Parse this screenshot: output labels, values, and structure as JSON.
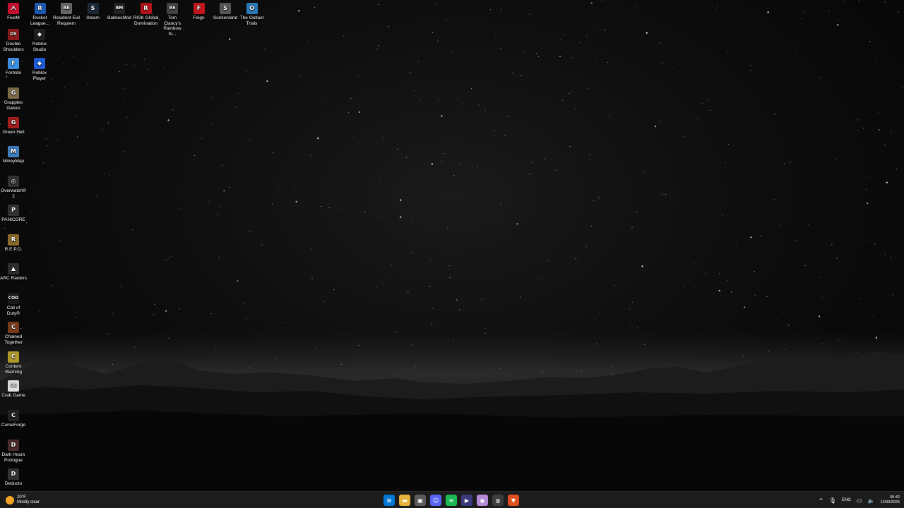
{
  "desktop_icons": [
    {
      "label": "FiveM",
      "glyph": "ᗅ",
      "color": "#c8102e"
    },
    {
      "label": "Rocket League...",
      "glyph": "R",
      "color": "#1c5bb5"
    },
    {
      "label": "Resident Evil Requiem",
      "glyph": "RE",
      "color": "#666666"
    },
    {
      "label": "Steam",
      "glyph": "S",
      "color": "#1b2838"
    },
    {
      "label": "BakkesMod",
      "glyph": "BM",
      "color": "#222222"
    },
    {
      "label": "RISK Global Domination",
      "glyph": "R",
      "color": "#b3121b"
    },
    {
      "label": "Tom Clancy's Rainbow Si...",
      "glyph": "R6",
      "color": "#444444"
    },
    {
      "label": "Feign",
      "glyph": "F",
      "color": "#c4161c"
    },
    {
      "label": "Sunkenland",
      "glyph": "S",
      "color": "#555555"
    },
    {
      "label": "The Outlast Trials",
      "glyph": "O",
      "color": "#2a7ab8"
    },
    {
      "label": "Double Shoulders",
      "glyph": "DS",
      "color": "#8b1a1a"
    },
    {
      "label": "Roblox Studio",
      "glyph": "◆",
      "color": "#1f1f1f"
    },
    {
      "label": "Fortnite",
      "glyph": "F",
      "color": "#3b8fe0"
    },
    {
      "label": "Roblox Player",
      "glyph": "◆",
      "color": "#1e5bd8"
    },
    {
      "label": "Grapples Galore",
      "glyph": "G",
      "color": "#7a6a45"
    },
    {
      "label": "Green Hell",
      "glyph": "G",
      "color": "#a01e1e"
    },
    {
      "label": "MineyMap",
      "glyph": "M",
      "color": "#3f7fbf"
    },
    {
      "label": "Overwatch® 2",
      "glyph": "◎",
      "color": "#303030"
    },
    {
      "label": "PANICORE",
      "glyph": "P",
      "color": "#333333"
    },
    {
      "label": "R.E.P.O.",
      "glyph": "R",
      "color": "#8a6a2a"
    },
    {
      "label": "ARC Raiders",
      "glyph": "▲",
      "color": "#2f2f2f"
    },
    {
      "label": "Call of Duty®",
      "glyph": "COD",
      "color": "#1a1a1a"
    },
    {
      "label": "Chained Together",
      "glyph": "C",
      "color": "#7a3b1a"
    },
    {
      "label": "Content Warning",
      "glyph": "C",
      "color": "#b09a2a"
    },
    {
      "label": "Crab Game",
      "glyph": "CG",
      "color": "#dddddd"
    },
    {
      "label": "CurseForge",
      "glyph": "C",
      "color": "#222222"
    },
    {
      "label": "Dark Hours Prologue",
      "glyph": "D",
      "color": "#4a2a2a"
    },
    {
      "label": "Deducto",
      "glyph": "D",
      "color": "#333333"
    }
  ],
  "taskbar": {
    "weather": {
      "temp": "20°F",
      "condition": "Mostly clear",
      "icon": "sun-icon"
    },
    "apps": [
      {
        "name": "start-icon",
        "glyph": "⊞",
        "bg": "#0078d4"
      },
      {
        "name": "file-explorer-icon",
        "glyph": "▬",
        "bg": "#e6b33a"
      },
      {
        "name": "microsoft-store-icon",
        "glyph": "▣",
        "bg": "#5c5c5c"
      },
      {
        "name": "discord-icon",
        "glyph": "☺",
        "bg": "#5865f2"
      },
      {
        "name": "spotify-icon",
        "glyph": "≋",
        "bg": "#1db954"
      },
      {
        "name": "media-player-icon",
        "glyph": "▶",
        "bg": "#3a3a7a"
      },
      {
        "name": "app-icon",
        "glyph": "◉",
        "bg": "#b58ad8"
      },
      {
        "name": "chrome-icon",
        "glyph": "◍",
        "bg": "#3b3b3b"
      },
      {
        "name": "brave-icon",
        "glyph": "▼",
        "bg": "#e0501f"
      }
    ],
    "tray": {
      "chevron": "^",
      "mic": "🎙",
      "language": "ENG",
      "network": "▭",
      "volume": "🔈",
      "time": "06:42",
      "date": "12/03/2026"
    }
  }
}
